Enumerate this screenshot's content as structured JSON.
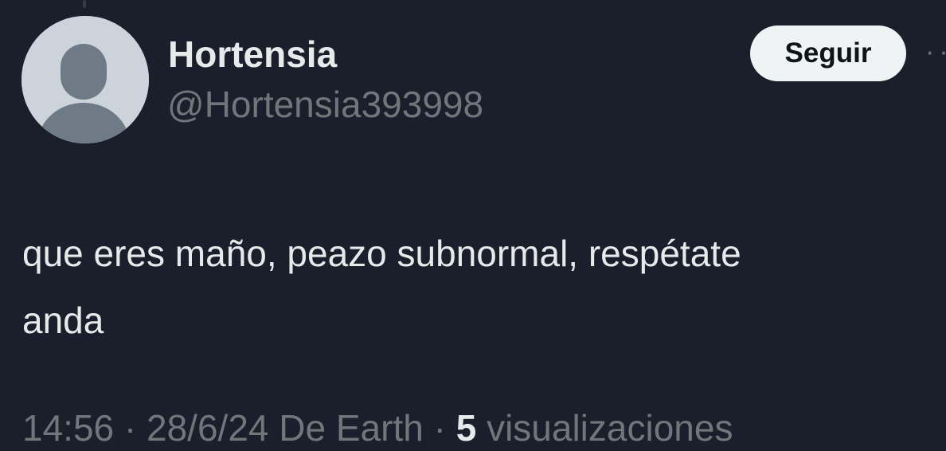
{
  "tweet": {
    "author": {
      "display_name": "Hortensia",
      "handle": "@Hortensia393998",
      "avatar": "default-avatar-icon"
    },
    "follow_button_label": "Seguir",
    "more_options_icon": "more-icon",
    "text_line_1": "que eres maño, peazo subnormal, respétate",
    "text_line_2": "anda",
    "time": "14:56",
    "separator_1": " · ",
    "date_source": "28/6/24 De Earth",
    "separator_2": " · ",
    "views_count": "5",
    "views_label": " visualizaciones"
  },
  "colors": {
    "background": "#1a1f2b",
    "primary_text": "#e7e9ea",
    "secondary_text": "#71767b",
    "button_bg": "#eff3f4"
  }
}
